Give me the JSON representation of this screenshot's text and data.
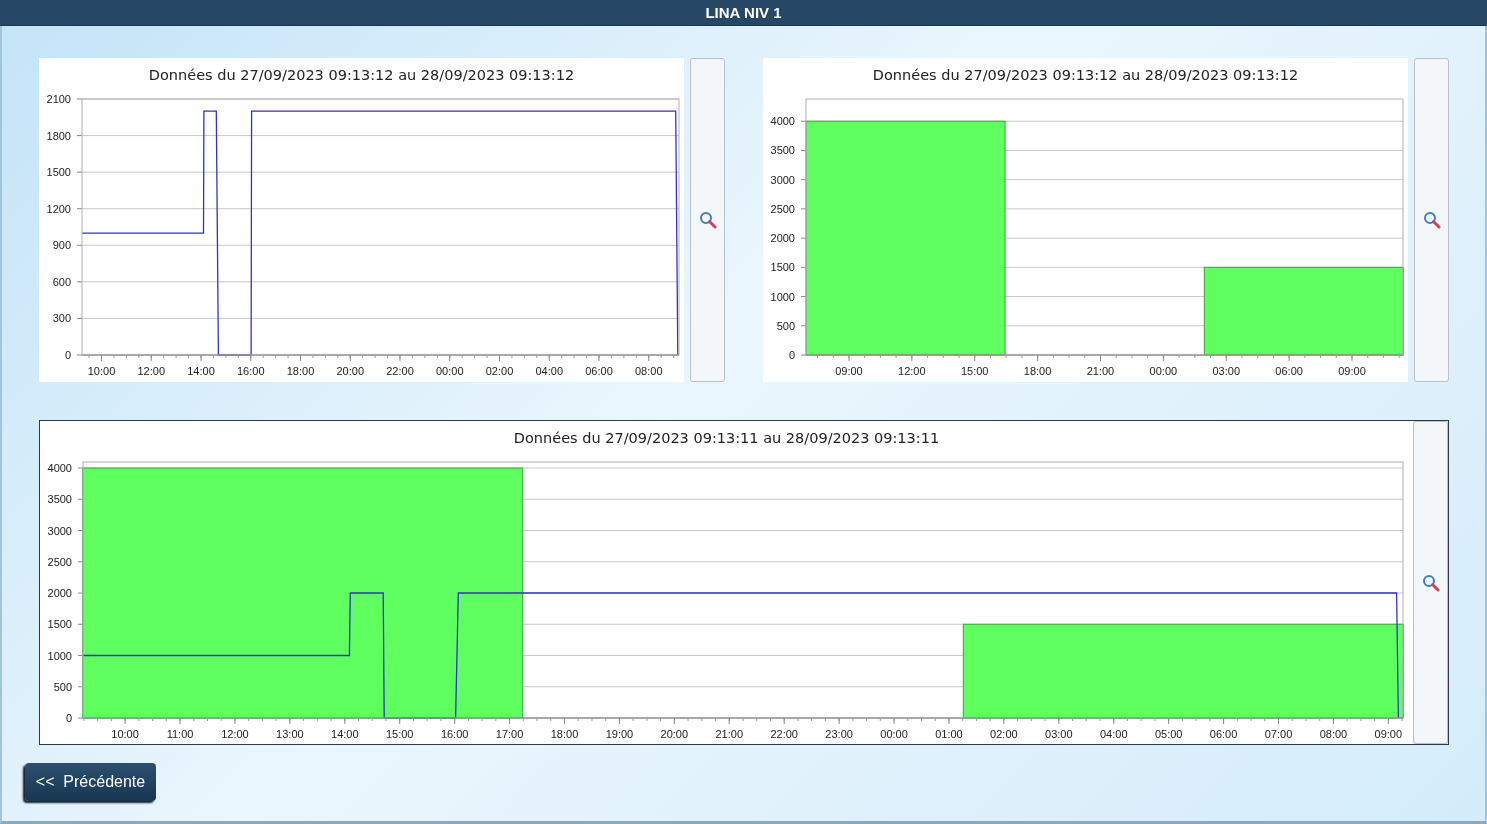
{
  "window": {
    "title": "LINA NIV 1"
  },
  "panels": [
    {
      "framed": false,
      "chart_data": {
        "type": "line",
        "title": "Données du 27/09/2023 09:13:12 au 28/09/2023 09:13:12",
        "grid": true,
        "xlim": [
          "2023-09-27 09:13",
          "2023-09-28 09:13"
        ],
        "ylim": [
          0,
          2100
        ],
        "xticks": [
          {
            "value": "2023-09-27 10:00",
            "label": "10:00"
          },
          {
            "value": "2023-09-27 12:00",
            "label": "12:00"
          },
          {
            "value": "2023-09-27 14:00",
            "label": "14:00"
          },
          {
            "value": "2023-09-27 16:00",
            "label": "16:00"
          },
          {
            "value": "2023-09-27 18:00",
            "label": "18:00"
          },
          {
            "value": "2023-09-27 20:00",
            "label": "20:00"
          },
          {
            "value": "2023-09-27 22:00",
            "label": "22:00"
          },
          {
            "value": "2023-09-28 00:00",
            "label": "00:00"
          },
          {
            "value": "2023-09-28 02:00",
            "label": "02:00"
          },
          {
            "value": "2023-09-28 04:00",
            "label": "04:00"
          },
          {
            "value": "2023-09-28 06:00",
            "label": "06:00"
          },
          {
            "value": "2023-09-28 08:00",
            "label": "08:00"
          }
        ],
        "yticks": [
          0,
          300,
          600,
          900,
          1200,
          1500,
          1800,
          2100
        ],
        "x": [
          "2023-09-27 09:13",
          "2023-09-27 14:06",
          "2023-09-27 14:07",
          "2023-09-27 14:37",
          "2023-09-27 14:42",
          "2023-09-27 16:01",
          "2023-09-27 16:02",
          "2023-09-28 09:05",
          "2023-09-28 09:10"
        ],
        "series": [
          {
            "color": "#3232c8",
            "values": [
              1000,
              1000,
              2000,
              2000,
              0,
              0,
              2000,
              2000,
              0
            ]
          }
        ]
      }
    },
    {
      "framed": false,
      "chart_data": {
        "type": "bar",
        "title": "Données du 27/09/2023 09:13:12 au 28/09/2023 09:13:12",
        "grid": true,
        "xlim": [
          "2023-09-27 06:57",
          "2023-09-28 11:26"
        ],
        "ylim": [
          0,
          4380
        ],
        "xticks": [
          {
            "value": "2023-09-27 09:00",
            "label": "09:00"
          },
          {
            "value": "2023-09-27 12:00",
            "label": "12:00"
          },
          {
            "value": "2023-09-27 15:00",
            "label": "15:00"
          },
          {
            "value": "2023-09-27 18:00",
            "label": "18:00"
          },
          {
            "value": "2023-09-27 21:00",
            "label": "21:00"
          },
          {
            "value": "2023-09-28 00:00",
            "label": "00:00"
          },
          {
            "value": "2023-09-28 03:00",
            "label": "03:00"
          },
          {
            "value": "2023-09-28 06:00",
            "label": "06:00"
          },
          {
            "value": "2023-09-28 09:00",
            "label": "09:00"
          }
        ],
        "yticks": [
          0,
          500,
          1000,
          1500,
          2000,
          2500,
          3000,
          3500,
          4000
        ],
        "x": [
          "2023-09-27 11:42",
          "2023-09-27 21:12",
          "2023-09-28 06:42"
        ],
        "series": [
          {
            "color": "#5cff5c",
            "values": [
              4000,
              0,
              1500
            ]
          }
        ]
      }
    },
    {
      "framed": true,
      "chart_data": {
        "type": "bar",
        "title": "Données du 27/09/2023 09:13:11 au 28/09/2023 09:13:11",
        "grid": true,
        "xlim": [
          "2023-09-27 09:14",
          "2023-09-28 09:16"
        ],
        "ylim": [
          0,
          4096
        ],
        "xticks": [
          {
            "value": "2023-09-27 10:00",
            "label": "10:00"
          },
          {
            "value": "2023-09-27 11:00",
            "label": "11:00"
          },
          {
            "value": "2023-09-27 12:00",
            "label": "12:00"
          },
          {
            "value": "2023-09-27 13:00",
            "label": "13:00"
          },
          {
            "value": "2023-09-27 14:00",
            "label": "14:00"
          },
          {
            "value": "2023-09-27 15:00",
            "label": "15:00"
          },
          {
            "value": "2023-09-27 16:00",
            "label": "16:00"
          },
          {
            "value": "2023-09-27 17:00",
            "label": "17:00"
          },
          {
            "value": "2023-09-27 18:00",
            "label": "18:00"
          },
          {
            "value": "2023-09-27 19:00",
            "label": "19:00"
          },
          {
            "value": "2023-09-27 20:00",
            "label": "20:00"
          },
          {
            "value": "2023-09-27 21:00",
            "label": "21:00"
          },
          {
            "value": "2023-09-27 22:00",
            "label": "22:00"
          },
          {
            "value": "2023-09-27 23:00",
            "label": "23:00"
          },
          {
            "value": "2023-09-28 00:00",
            "label": "00:00"
          },
          {
            "value": "2023-09-28 01:00",
            "label": "01:00"
          },
          {
            "value": "2023-09-28 02:00",
            "label": "02:00"
          },
          {
            "value": "2023-09-28 03:00",
            "label": "03:00"
          },
          {
            "value": "2023-09-28 04:00",
            "label": "04:00"
          },
          {
            "value": "2023-09-28 05:00",
            "label": "05:00"
          },
          {
            "value": "2023-09-28 06:00",
            "label": "06:00"
          },
          {
            "value": "2023-09-28 07:00",
            "label": "07:00"
          },
          {
            "value": "2023-09-28 08:00",
            "label": "08:00"
          },
          {
            "value": "2023-09-28 09:00",
            "label": "09:00"
          }
        ],
        "yticks": [
          0,
          500,
          1000,
          1500,
          2000,
          2500,
          3000,
          3500,
          4000
        ],
        "series": [
          {
            "color": "#5cff5c",
            "x": [
              "2023-09-27 13:14",
              "2023-09-27 21:15",
              "2023-09-28 05:16"
            ],
            "values": [
              4000,
              0,
              1500
            ]
          },
          {
            "type": "line",
            "color": "#3232c8",
            "x": [
              "2023-09-27 09:14",
              "2023-09-27 14:05",
              "2023-09-27 14:06",
              "2023-09-27 14:42",
              "2023-09-27 14:43",
              "2023-09-27 16:01",
              "2023-09-27 16:04",
              "2023-09-28 09:09",
              "2023-09-28 09:11"
            ],
            "values": [
              1000,
              1000,
              2000,
              2000,
              0,
              0,
              2000,
              2000,
              0
            ]
          }
        ]
      }
    }
  ],
  "buttons": [
    {
      "label": "<<  Précédente"
    }
  ]
}
